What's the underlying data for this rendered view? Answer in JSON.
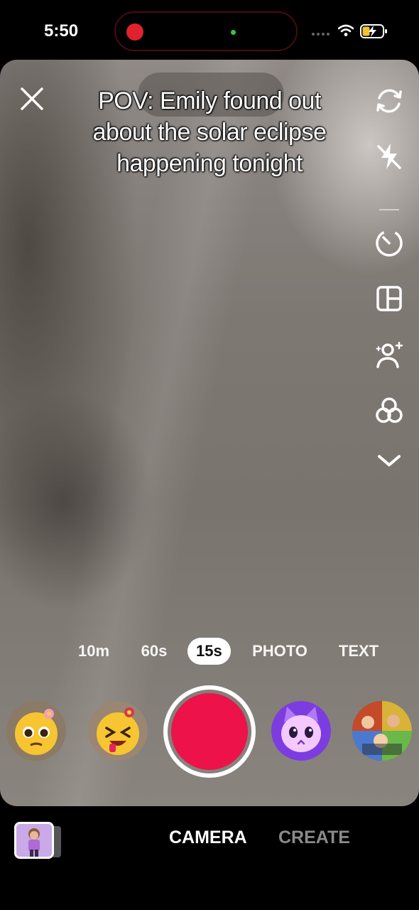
{
  "status_bar": {
    "time": "5:50"
  },
  "caption": {
    "line1": "POV: Emily found out",
    "line2": "about the solar eclipse",
    "line3": "happening tonight"
  },
  "right_rail": [
    {
      "name": "flip",
      "icon": "flip-camera-icon"
    },
    {
      "name": "flash",
      "icon": "flash-off-icon"
    },
    {
      "name": "timer",
      "icon": "timer-icon"
    },
    {
      "name": "layout",
      "icon": "layout-icon"
    },
    {
      "name": "beauty",
      "icon": "retouch-icon"
    },
    {
      "name": "filters",
      "icon": "filters-icon"
    },
    {
      "name": "more",
      "icon": "chevron-down-icon"
    }
  ],
  "modes": {
    "m10": "10m",
    "m60": "60s",
    "m15": "15s",
    "photo": "PHOTO",
    "text": "TEXT",
    "selected": "15s"
  },
  "effects": [
    "pleading-face-flower",
    "laughing-face-flower",
    "purple-cat-face",
    "photo-collage"
  ],
  "bottom_tabs": {
    "camera": "CAMERA",
    "create": "CREATE",
    "active": "CAMERA"
  },
  "colors": {
    "shutter": "#ed1249",
    "recording_dot": "#e0222d",
    "mic_dot": "#2ecc40"
  }
}
